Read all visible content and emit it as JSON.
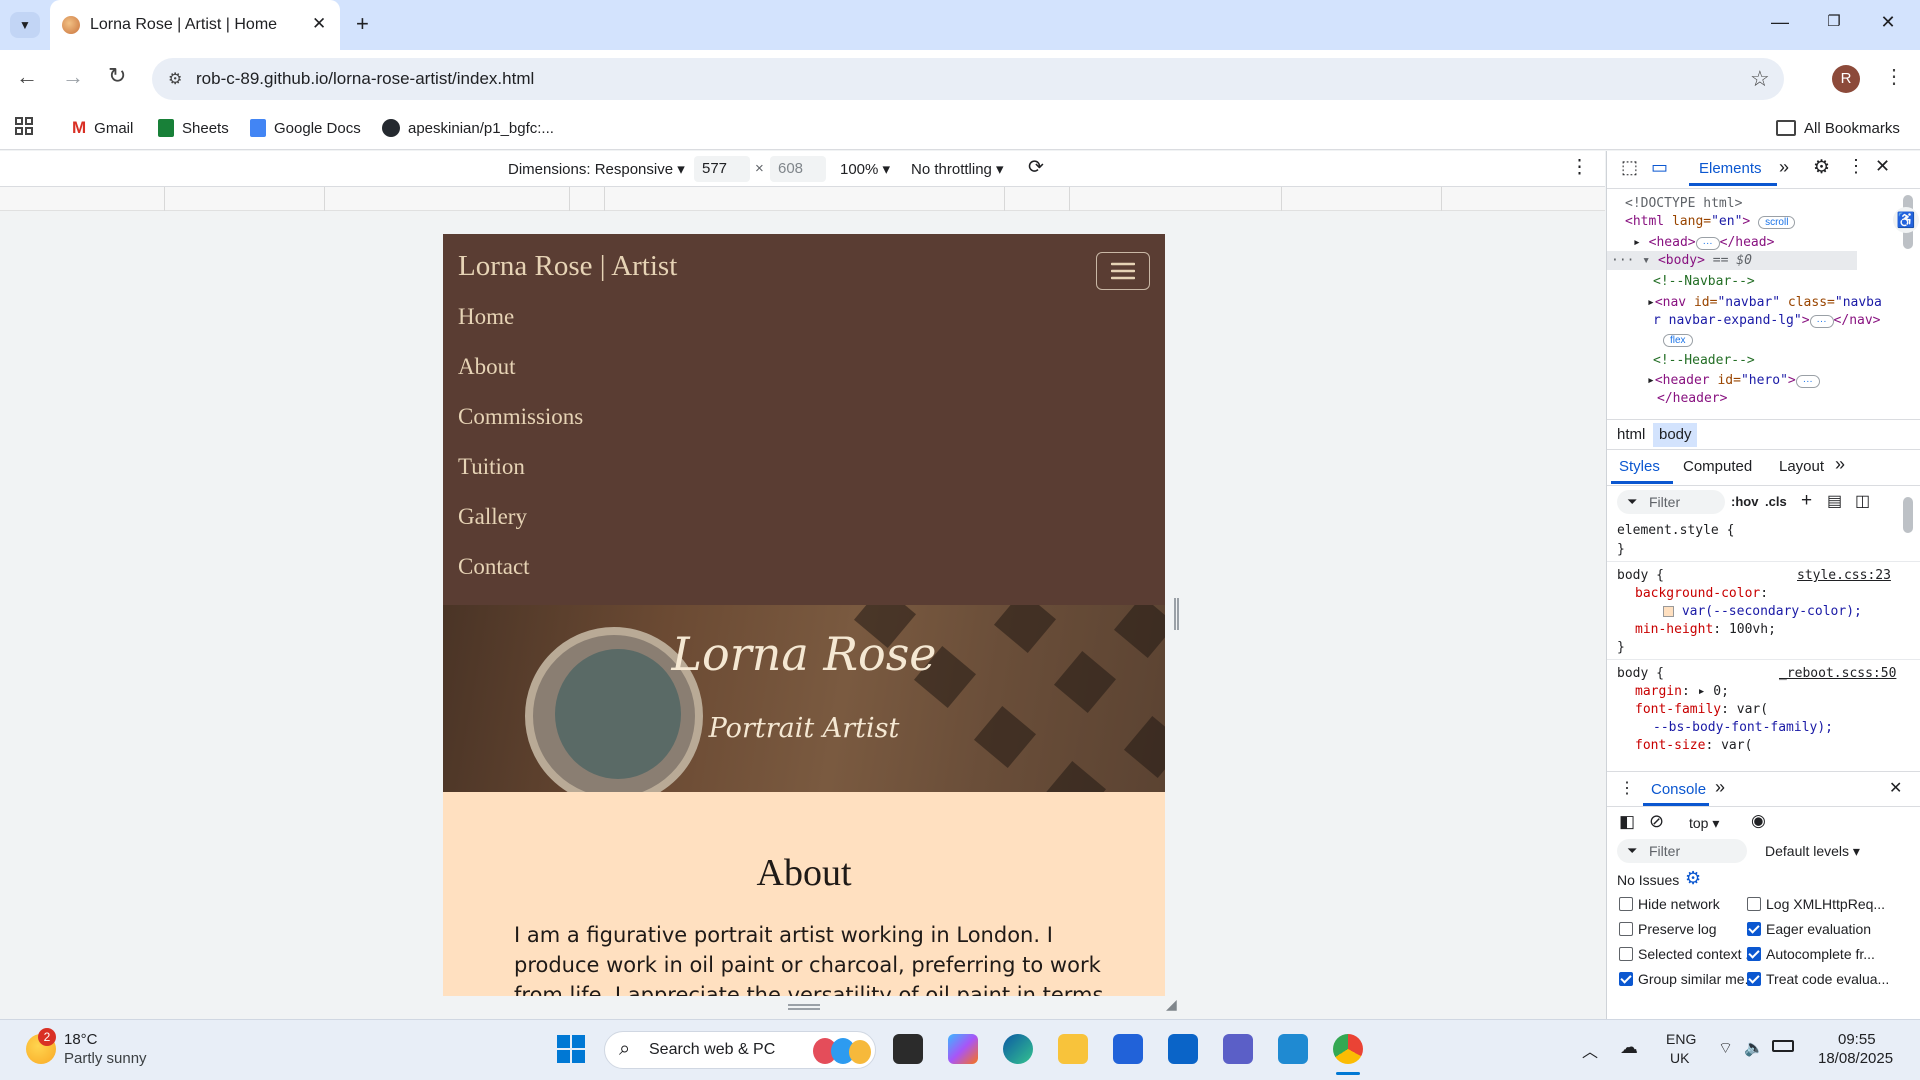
{
  "browser": {
    "tab_title": "Lorna Rose | Artist | Home",
    "url": "rob-c-89.github.io/lorna-rose-artist/index.html",
    "profile_initial": "R",
    "bookmarks": [
      "Gmail",
      "Sheets",
      "Google Docs",
      "apeskinian/p1_bgfc:..."
    ],
    "all_bookmarks": "All Bookmarks"
  },
  "device_toolbar": {
    "dimensions": "Dimensions: Responsive",
    "width": "577",
    "times": "×",
    "height": "608",
    "zoom": "100%",
    "throttling": "No throttling"
  },
  "site": {
    "brand": "Lorna Rose | Artist",
    "nav": [
      "Home",
      "About",
      "Commissions",
      "Tuition",
      "Gallery",
      "Contact"
    ],
    "hero_title": "Lorna Rose",
    "hero_subtitle": "Portrait Artist",
    "about_heading": "About",
    "about_text": "I am a figurative portrait artist working in London. I produce work in oil paint or charcoal, preferring to work from life. I appreciate the versatility of oil paint in terms of mark"
  },
  "devtools": {
    "tab_elements": "Elements",
    "dom": {
      "doctype": "<!DOCTYPE html>",
      "html_open": "<html",
      "html_attr": " lang=",
      "html_val": "\"en\"",
      "html_close": ">",
      "scroll_badge": "scroll",
      "head": "<head>",
      "head_close": "</head>",
      "ellipsis": "···",
      "body": "<body>",
      "body_eq": "== $0",
      "comment_navbar": "<!--Navbar-->",
      "nav_line1_tag": "<nav",
      "nav_line1_attr": " id=",
      "nav_line1_val": "\"navbar\"",
      "nav_line1_attr2": " class=",
      "nav_line1_val2": "\"navba",
      "nav_line2_val": "r navbar-expand-lg\"",
      "nav_line2_tag": ">",
      "nav_close": "</nav>",
      "flex_badge": "flex",
      "comment_header": "<!--Header-->",
      "header_tag": "<header",
      "header_attr": " id=",
      "header_val": "\"hero\"",
      "header_gt": ">",
      "header_close": "</header>"
    },
    "breadcrumbs": [
      "html",
      "body"
    ],
    "style_tabs": [
      "Styles",
      "Computed",
      "Layout"
    ],
    "filter_placeholder": "Filter",
    "hov": ":hov",
    "cls": ".cls",
    "styles": {
      "element_style": "element.style {",
      "close_brace": "}",
      "body_sel": "body {",
      "source1": "style.css:23",
      "bg_prop": "background-color",
      "bg_val": "var(--secondary-color);",
      "minh_prop": "min-height",
      "minh_val": "100vh;",
      "source2": "_reboot.scss:50",
      "margin_prop": "margin",
      "margin_val": "0;",
      "ff_prop": "font-family",
      "ff_val": "var(",
      "ff_val2": "--bs-body-font-family);",
      "fs_prop": "font-size",
      "fs_val": "var("
    },
    "console": {
      "tab": "Console",
      "context": "top",
      "filter_placeholder": "Filter",
      "levels": "Default levels",
      "no_issues": "No Issues",
      "checkboxes": [
        {
          "label": "Hide network",
          "checked": false
        },
        {
          "label": "Log XMLHttpReq...",
          "checked": false
        },
        {
          "label": "Preserve log",
          "checked": false
        },
        {
          "label": "Eager evaluation",
          "checked": true
        },
        {
          "label": "Selected context ...",
          "checked": false
        },
        {
          "label": "Autocomplete fr...",
          "checked": true
        },
        {
          "label": "Group similar me...",
          "checked": true
        },
        {
          "label": "Treat code evalua...",
          "checked": true
        }
      ]
    }
  },
  "taskbar": {
    "weather_badge": "2",
    "temperature": "18°C",
    "weather": "Partly sunny",
    "search_placeholder": "Search web & PC",
    "lang1": "ENG",
    "lang2": "UK",
    "time": "09:55",
    "date": "18/08/2025"
  },
  "colors": {
    "navbar": "#5a3d33",
    "nav_text": "#e6d3b5",
    "page_bg": "#ffe0c0",
    "devtools_accent": "#0b57d0"
  }
}
